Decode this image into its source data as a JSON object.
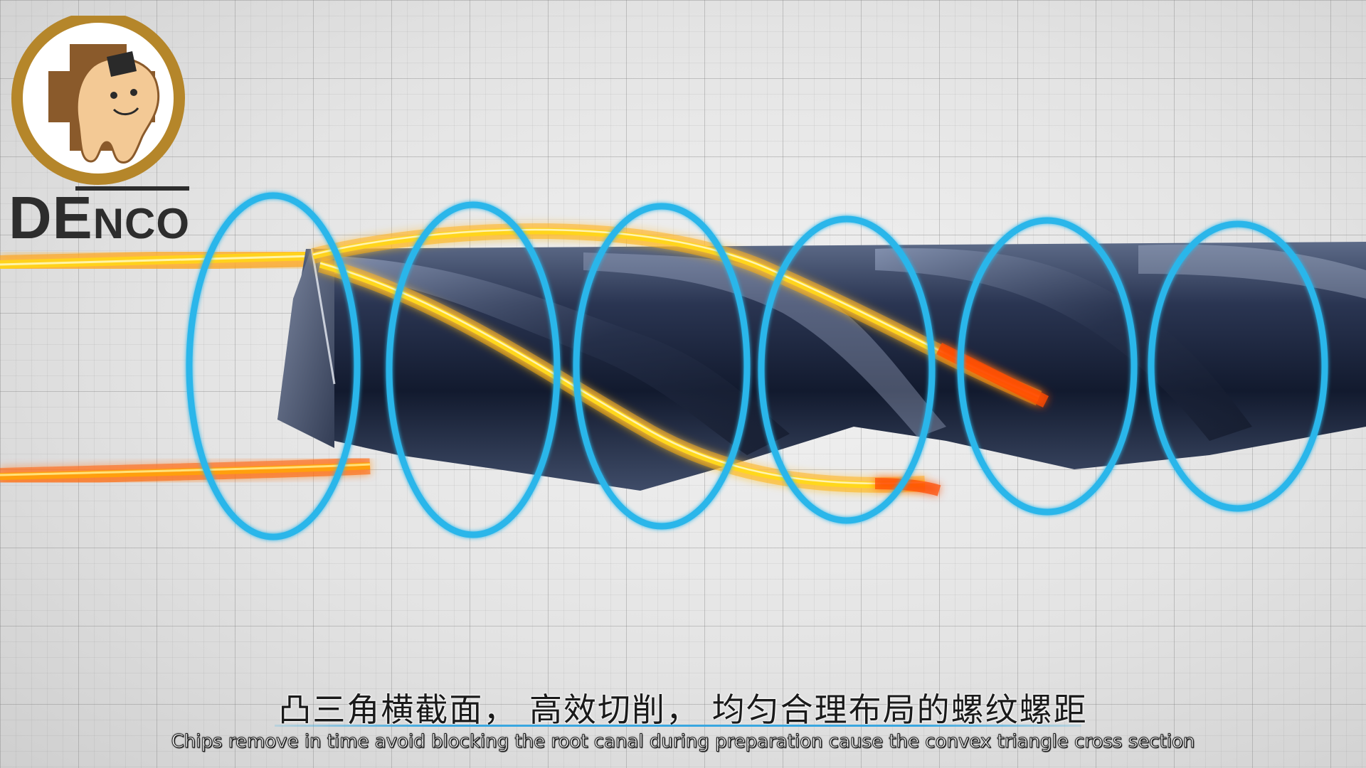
{
  "logo": {
    "text_big": "DE",
    "text_small": "NCO",
    "accent_color": "#b5862a"
  },
  "subtitles": {
    "chinese": "凸三角横截面， 高效切削， 均匀合理布局的螺纹螺距",
    "english": "Chips remove in time avoid blocking the root canal during preparation cause the convex triangle cross section"
  },
  "colors": {
    "ring": "#29b6ea",
    "chip_stream": "#ffc400",
    "chip_hot": "#ff5a00",
    "drill_body": "#1e2a44"
  }
}
